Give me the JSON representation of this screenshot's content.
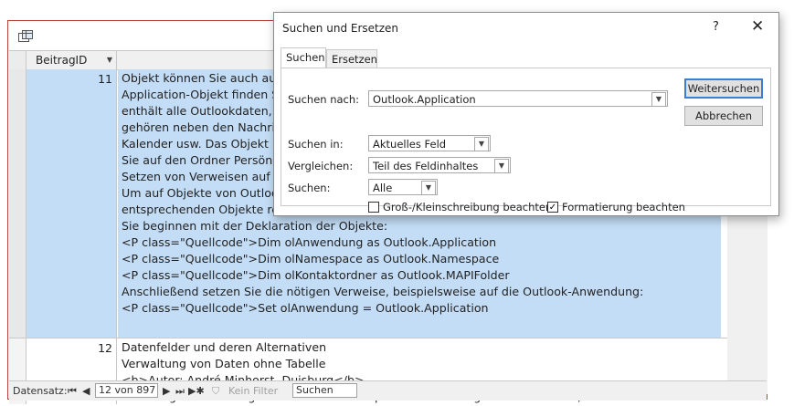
{
  "table": {
    "column_header": "BeitragID",
    "rows": [
      {
        "id": "11",
        "lines": [
          "Objekt können Sie auch auf",
          "Application-Objekt finden S",
          "enthält alle Outlookdaten, d",
          "gehören neben den Nachrich",
          "Kalender usw. Das Objekt Fo",
          "Sie auf den Ordner Persönlic",
          "Setzen von Verweisen auf O",
          "Um auf Objekte von Outlook",
          "entsprechenden Objekte ref",
          "Sie beginnen mit der Deklaration der Objekte:",
          "<P class=\"Quellcode\">Dim olAnwendung as Outlook.Application",
          "<P class=\"Quellcode\">Dim olNamespace as Outlook.Namespace",
          "<P class=\"Quellcode\">Dim olKontaktordner as Outlook.MAPIFolder",
          "Anschließend setzen Sie die nötigen Verweise, beispielsweise auf die Outlook-Anwendung:",
          "<P class=\"Quellcode\">Set olAnwendung = Outlook.Application"
        ]
      },
      {
        "id": "12",
        "lines": [
          "Datenfelder und deren Alternativen",
          "Verwaltung von Daten ohne Tabelle",
          "<b>Autor: André Minhorst, Duisburg</b>",
          "<b>Einige Anwendungen erfordern die temporäre Verwaltung von Daten - d.h., die Daten werden im"
        ]
      }
    ]
  },
  "nav": {
    "label": "Datensatz:",
    "first": "⏮",
    "prev": "◀",
    "record": "12 von 897",
    "next": "▶",
    "last": "⏭",
    "new": "▶✱",
    "filter": "Kein Filter",
    "search": "Suchen"
  },
  "dialog": {
    "title": "Suchen und Ersetzen",
    "help": "?",
    "close": "✕",
    "tabs": [
      "Suchen",
      "Ersetzen"
    ],
    "find_label": "Suchen nach:",
    "find_value": "Outlook.Application",
    "lookin_label": "Suchen in:",
    "lookin_value": "Aktuelles Feld",
    "match_label": "Vergleichen:",
    "match_value": "Teil des Feldinhaltes",
    "search_label": "Suchen:",
    "search_value": "Alle",
    "case_label": "Groß-/Kleinschreibung beachten",
    "case_checked": false,
    "format_label": "Formatierung beachten",
    "format_checked": true,
    "find_next": "Weitersuchen",
    "cancel": "Abbrechen"
  },
  "colors": {
    "active_row": "#c4ddf6",
    "window_border": "#b8433a",
    "default_button": "#3c7fd1"
  }
}
